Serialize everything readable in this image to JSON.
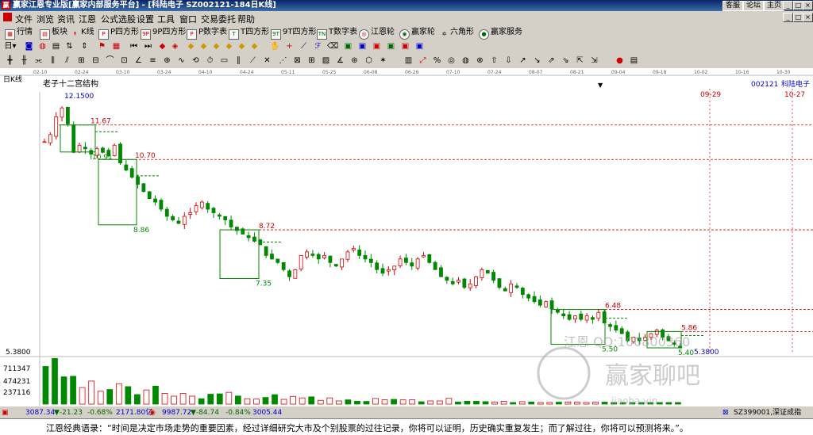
{
  "window": {
    "title": "赢家江恩专业版[赢家内部服务平台] - [科陆电子  SZ002121-184日K线]",
    "links": [
      "客服",
      "论坛",
      "主页"
    ]
  },
  "menu": [
    "文件",
    "浏览",
    "资讯",
    "江恩",
    "公式选股",
    "设置",
    "工具",
    "窗口",
    "交易委托",
    "帮助"
  ],
  "toolbar1": [
    {
      "icon": "grid-icon",
      "label": "行情"
    },
    {
      "icon": "blocks-icon",
      "label": "板块"
    },
    {
      "icon": "candle-icon",
      "label": "K线"
    },
    {
      "icon": "p-square-icon",
      "glyph": "P",
      "label": "P四方形"
    },
    {
      "icon": "9p-square-icon",
      "glyph": "9P",
      "label": "9P四方形"
    },
    {
      "icon": "p-table-icon",
      "glyph": "P",
      "label": "P数字表"
    },
    {
      "icon": "t-square-icon",
      "glyph": "T",
      "label": "T四方形"
    },
    {
      "icon": "9t-square-icon",
      "glyph": "9T",
      "label": "9T四方形"
    },
    {
      "icon": "t-table-icon",
      "glyph": "TN",
      "label": "T数字表"
    },
    {
      "icon": "gann-wheel-icon",
      "label": "江恩轮"
    },
    {
      "icon": "winner-wheel-icon",
      "label": "赢家轮"
    },
    {
      "icon": "hexagon-icon",
      "label": "六角形"
    },
    {
      "icon": "service-icon",
      "label": "赢家服务"
    }
  ],
  "chart": {
    "period_label": "日K线",
    "structure_label": "老子十二宫结构",
    "code": "002121",
    "name": "科陆电子",
    "date_axis": [
      "02-10",
      "02-24",
      "03-10",
      "03-24",
      "04-10",
      "04-24",
      "05-11",
      "05-25",
      "06-08",
      "06-26",
      "07-10",
      "07-24",
      "08-07",
      "08-21",
      "09-04",
      "09-18",
      "10-02",
      "10-16",
      "10-30"
    ],
    "forecast_dates": [
      "09-29",
      "10-27"
    ],
    "high_label": "12.1500",
    "low_label": "5.3800",
    "left_price": "5.3800",
    "volume_labels": [
      "711347",
      "474231",
      "237116"
    ],
    "watermark": "江恩 QQ:100800360",
    "watermark_brand": "赢家聊吧",
    "watermark_url": "jiaoba.vip"
  },
  "gann_boxes": [
    {
      "top": "11.67",
      "bottom": "10.91"
    },
    {
      "top": "10.70",
      "bottom": "8.86"
    },
    {
      "top": "8.72",
      "bottom": "7.35"
    },
    {
      "top": "6.48",
      "bottom": "5.50"
    },
    {
      "top": "5.86",
      "bottom": "5.40"
    }
  ],
  "chart_data": {
    "type": "candlestick",
    "title": "",
    "x_start": "02-10",
    "x_end": "10-30",
    "y_range": [
      5.38,
      12.15
    ],
    "highest": 12.15,
    "lowest": 5.38,
    "resistance_levels": [
      11.67,
      10.7,
      8.72,
      6.48,
      5.86
    ],
    "support_levels": [
      10.91,
      8.86,
      7.35,
      5.5,
      5.4
    ],
    "price_trend": [
      11.2,
      11.4,
      11.9,
      12.15,
      11.7,
      10.9,
      11.1,
      11.0,
      10.85,
      11.0,
      10.9,
      10.8,
      11.1,
      10.6,
      10.4,
      10.2,
      10.0,
      9.8,
      9.6,
      9.5,
      9.3,
      9.1,
      9.0,
      8.9,
      9.1,
      9.2,
      9.4,
      9.5,
      9.3,
      9.2,
      9.1,
      9.0,
      8.8,
      8.7,
      8.6,
      8.5,
      8.4,
      8.3,
      8.0,
      7.9,
      7.8,
      7.6,
      7.4,
      7.6,
      8.0,
      8.1,
      8.0,
      7.9,
      8.0,
      7.8,
      7.7,
      7.9,
      8.1,
      8.2,
      8.0,
      7.9,
      7.8,
      7.6,
      7.5,
      7.6,
      7.7,
      7.9,
      7.8,
      7.7,
      7.9,
      8.0,
      7.8,
      7.6,
      7.4,
      7.3,
      7.2,
      7.3,
      7.1,
      7.2,
      7.4,
      7.6,
      7.5,
      7.3,
      7.1,
      7.0,
      7.2,
      7.1,
      6.9,
      6.8,
      6.7,
      6.6,
      6.7,
      6.5,
      6.4,
      6.3,
      6.2,
      6.3,
      6.2,
      6.3,
      6.2,
      6.4,
      6.1,
      6.0,
      5.9,
      5.8,
      5.6,
      5.7,
      5.6,
      5.7,
      5.8,
      5.9,
      5.7,
      5.6,
      5.5,
      5.4
    ],
    "volume_ticks": [
      711347,
      474231,
      237116
    ],
    "volume_trend": [
      900000,
      700000,
      500000,
      420000,
      380000,
      350000,
      300000,
      260000,
      320000,
      280000,
      250000,
      230000,
      300000,
      260000,
      240000,
      220000,
      200000,
      180000,
      240000,
      220000,
      180000,
      160000,
      150000,
      140000,
      130000,
      160000,
      150000,
      140000,
      120000,
      110000,
      100000,
      95000,
      90000,
      85000,
      80000,
      90000,
      85000,
      80000,
      75000,
      70000,
      80000,
      75000,
      70000,
      65000,
      90000,
      60000,
      55000,
      50000,
      60000,
      55000,
      45000,
      40000,
      42000,
      38000,
      36000,
      34000,
      40000,
      35000,
      32000,
      30000,
      28000,
      30000,
      26000,
      25000,
      24000,
      22000,
      20000,
      18000,
      20000,
      18000
    ]
  },
  "status": {
    "index1": "3087.34",
    "index1_change": "▼-21.23",
    "index1_pct": "-0.68%",
    "index1_amount": "2171.80亿",
    "index2": "9987.72",
    "index2_change": "▼-84.74",
    "index2_pct": "-0.84%",
    "index2_amount": "3005.44",
    "right_ticker": "SZ399001,深证成指"
  },
  "quote": "江恩经典语录：“时间是决定市场走势的重要因素，经过详细研究大市及个别股票的过往记录，你将可以证明，历史确实重复发生；而了解过往，你将可以预测将来。”。"
}
